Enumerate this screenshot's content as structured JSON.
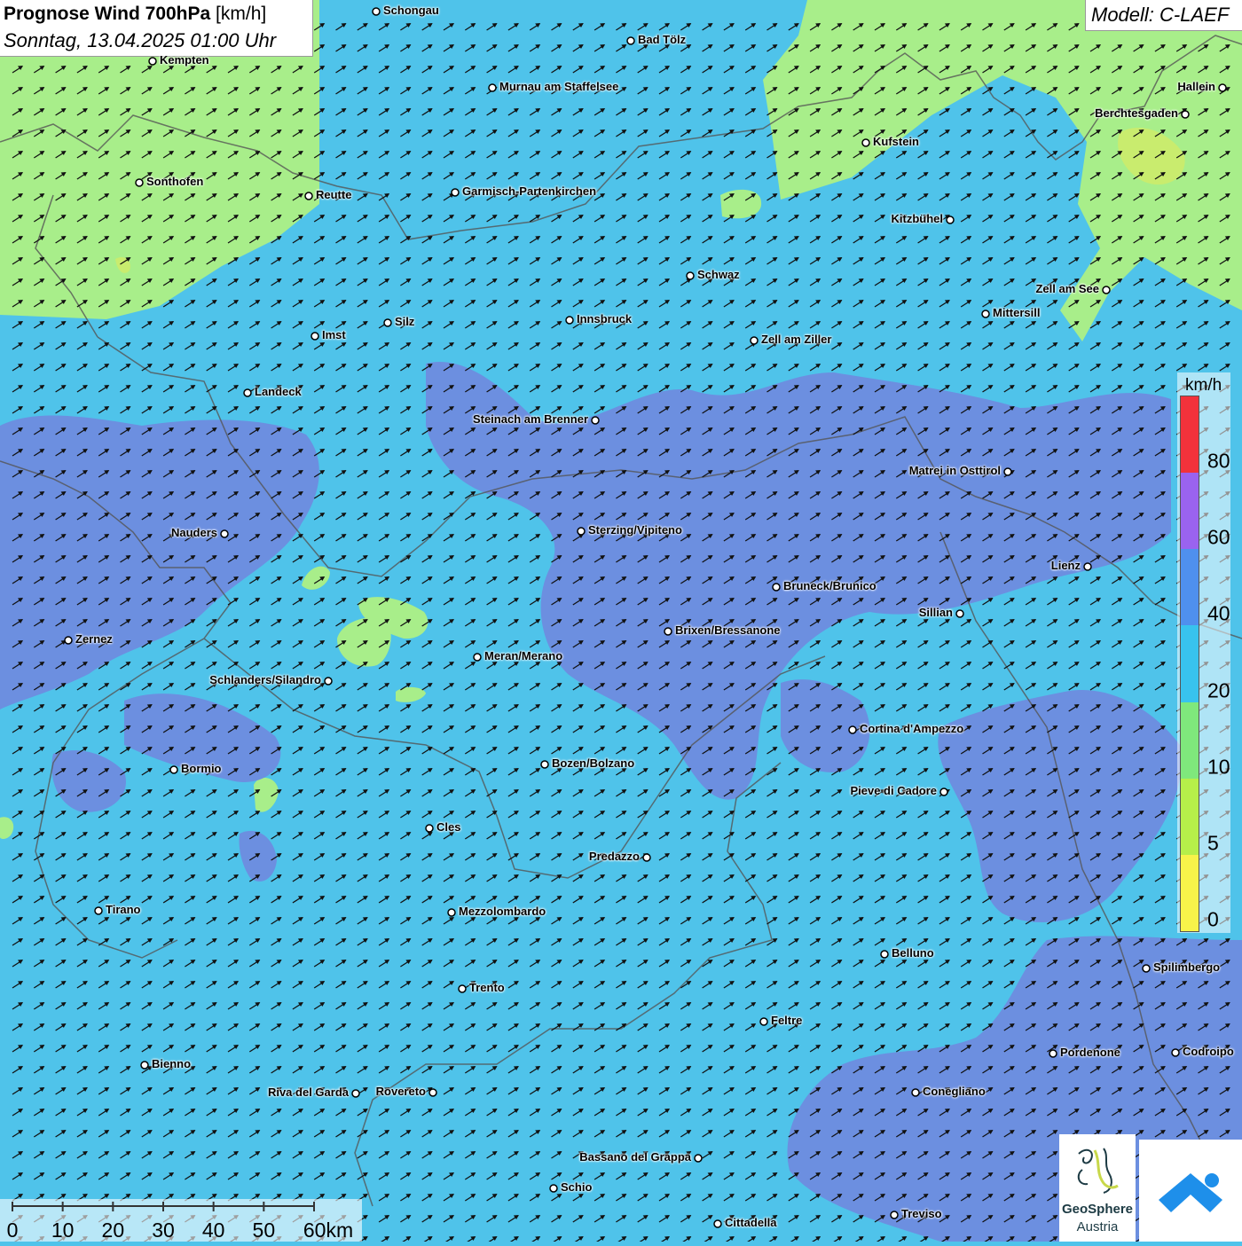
{
  "header": {
    "title_bold": "Prognose Wind 700hPa",
    "title_unit": "[km/h]",
    "subtitle": "Sonntag, 13.04.2025 01:00 Uhr",
    "model": "Modell: C-LAEF"
  },
  "legend": {
    "unit": "km/h",
    "ticks": [
      "0",
      "5",
      "10",
      "20",
      "40",
      "60",
      "80"
    ],
    "colors": [
      "#f7f34a",
      "#b6ef4a",
      "#7fe87c",
      "#38c3ee",
      "#4f90ee",
      "#9a63ef",
      "#f2323b"
    ]
  },
  "palette": {
    "wind_10_20": "#a8ee8a",
    "wind_20_40": "#4fc3ea",
    "wind_40_60": "#6c8fe0",
    "wind_5_10": "#c9ec6e",
    "arrow": "#111111",
    "border": "#555555"
  },
  "scale": {
    "ticks": [
      "0",
      "10",
      "20",
      "30",
      "40",
      "50",
      "60km"
    ]
  },
  "logos": {
    "geosphere_line1": "GeoSphere",
    "geosphere_line2": "Austria"
  },
  "cities": [
    {
      "name": "Schongau"
    },
    {
      "name": "Bad Tölz"
    },
    {
      "name": "Kempten"
    },
    {
      "name": "Hallein"
    },
    {
      "name": "Murnau am Staffelsee"
    },
    {
      "name": "Berchtesgaden"
    },
    {
      "name": "Kufstein"
    },
    {
      "name": "Sonthofen"
    },
    {
      "name": "Reutte"
    },
    {
      "name": "Garmisch-Partenkirchen"
    },
    {
      "name": "Kitzbühel"
    },
    {
      "name": "Schwaz"
    },
    {
      "name": "Zell am See"
    },
    {
      "name": "Mittersill"
    },
    {
      "name": "Innsbruck"
    },
    {
      "name": "Silz"
    },
    {
      "name": "Imst"
    },
    {
      "name": "Zell am Ziller"
    },
    {
      "name": "Landeck"
    },
    {
      "name": "Steinach am Brenner"
    },
    {
      "name": "Matrei in Osttirol"
    },
    {
      "name": "Nauders"
    },
    {
      "name": "Sterzing/Vipiteno"
    },
    {
      "name": "Lienz"
    },
    {
      "name": "Bruneck/Brunico"
    },
    {
      "name": "Sillian"
    },
    {
      "name": "Brixen/Bressanone"
    },
    {
      "name": "Zernez"
    },
    {
      "name": "Meran/Merano"
    },
    {
      "name": "Schlanders/Silandro"
    },
    {
      "name": "Cortina d'Ampezzo"
    },
    {
      "name": "Bozen/Bolzano"
    },
    {
      "name": "Bormio"
    },
    {
      "name": "Pieve di Cadore"
    },
    {
      "name": "Cles"
    },
    {
      "name": "Predazzo"
    },
    {
      "name": "Tirano"
    },
    {
      "name": "Mezzolombardo"
    },
    {
      "name": "Belluno"
    },
    {
      "name": "Spilimbergo"
    },
    {
      "name": "Trento"
    },
    {
      "name": "Feltre"
    },
    {
      "name": "Pordenone"
    },
    {
      "name": "Codroipo"
    },
    {
      "name": "Bienno"
    },
    {
      "name": "Riva del Garda"
    },
    {
      "name": "Rovereto"
    },
    {
      "name": "Conegliano"
    },
    {
      "name": "Bassano del Grappa"
    },
    {
      "name": "Schio"
    },
    {
      "name": "Treviso"
    },
    {
      "name": "Cittadella"
    }
  ]
}
